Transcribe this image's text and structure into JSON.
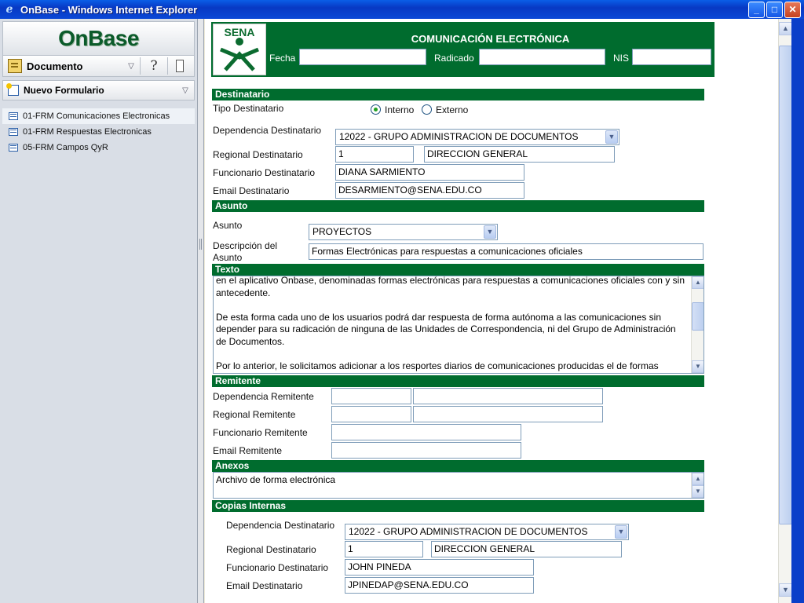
{
  "window": {
    "title": "OnBase - Windows Internet Explorer",
    "minimize": "_",
    "maximize": "□",
    "close": "✕"
  },
  "sidebar": {
    "logo": "OnBase",
    "nav_label": "Documento",
    "form_menu_label": "Nuevo Formulario",
    "forms": [
      {
        "label": "01-FRM Comunicaciones Electronicas"
      },
      {
        "label": "01-FRM Respuestas Electronicas"
      },
      {
        "label": "05-FRM Campos QyR"
      }
    ]
  },
  "header": {
    "logo_text": "SENA",
    "title": "COMUNICACIÓN ELECTRÓNICA",
    "fecha_label": "Fecha",
    "radicado_label": "Radicado",
    "nis_label": "NIS",
    "fecha_value": "",
    "radicado_value": "",
    "nis_value": ""
  },
  "destinatario": {
    "section": "Destinatario",
    "tipo_label": "Tipo Destinatario",
    "option_interno": "Interno",
    "option_externo": "Externo",
    "selected": "Interno",
    "dependencia_label": "Dependencia Destinatario",
    "dependencia_value": "12022 - GRUPO ADMINISTRACION DE DOCUMENTOS",
    "regional_label": "Regional Destinatario",
    "regional_code": "1",
    "regional_name": "DIRECCION GENERAL",
    "funcionario_label": "Funcionario Destinatario",
    "funcionario_value": "DIANA SARMIENTO",
    "email_label": "Email Destinatario",
    "email_value": "DESARMIENTO@SENA.EDU.CO"
  },
  "asunto": {
    "section": "Asunto",
    "asunto_label": "Asunto",
    "asunto_value": "PROYECTOS",
    "descripcion_label": "Descripción del\nAsunto",
    "descripcion_value": "Formas Electrónicas para respuestas a comunicaciones oficiales"
  },
  "texto": {
    "section": "Texto",
    "content": "en el aplicativo Onbase, denominadas formas electrónicas para respuestas a comunicaciones oficiales con y sin antecedente.\n\nDe esta forma cada uno de los usuarios podrá dar respuesta de forma autónoma a las comunicaciones sin depender para su radicación de ninguna de las Unidades de Correspondencia, ni del Grupo de Administración de Documentos.\n\nPor lo anterior, le solicitamos adicionar a los resportes diarios de comunicaciones producidas el de formas electrónicas producidas en el sistema Onbase."
  },
  "remitente": {
    "section": "Remitente",
    "dependencia_label": "Dependencia Remitente",
    "regional_label": "Regional Remitente",
    "funcionario_label": "Funcionario Remitente",
    "email_label": "Email Remitente",
    "dependencia_code": "",
    "dependencia_name": "",
    "regional_code": "",
    "regional_name": "",
    "funcionario_value": "",
    "email_value": ""
  },
  "anexos": {
    "section": "Anexos",
    "content": "Archivo de forma electrónica"
  },
  "copias": {
    "section": "Copias Internas",
    "dependencia_label": "Dependencia Destinatario",
    "dependencia_value": "12022 - GRUPO ADMINISTRACION DE DOCUMENTOS",
    "regional_label": "Regional Destinatario",
    "regional_code": "1",
    "regional_name": "DIRECCION GENERAL",
    "funcionario_label": "Funcionario Destinatario",
    "funcionario_value": "JOHN PINEDA",
    "email_label": "Email Destinatario",
    "email_value": "JPINEDAP@SENA.EDU.CO"
  },
  "colors": {
    "section_green": "#006c2e",
    "title_blue": "#0839c4"
  }
}
